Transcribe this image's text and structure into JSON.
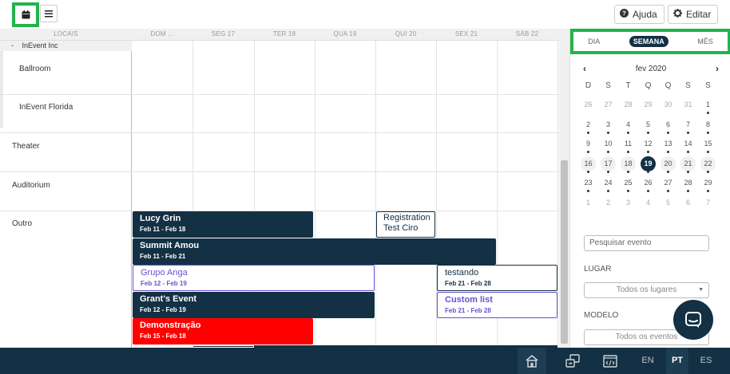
{
  "toolbar": {
    "calendar_icon": "calendar-icon",
    "list_icon": "list-icon",
    "help_label": "Ajuda",
    "edit_label": "Editar"
  },
  "grid": {
    "locations_header": "LOCAIS",
    "day_headers": [
      "DOM ...",
      "SEG 17",
      "TER 18",
      "QUA 19",
      "QUI 20",
      "SEX 21",
      "SÁB 22"
    ],
    "group": "InEvent Inc",
    "group_toggle": "-",
    "rows": [
      "Ballroom",
      "InEvent Florida",
      "Theater",
      "Auditorium",
      "Outro"
    ]
  },
  "events": [
    {
      "title": "Lucy Grin",
      "dates": "Feb 11 - Feb 18",
      "style": "dark"
    },
    {
      "title": "Registration Test Ciro",
      "dates": "",
      "style": "outline"
    },
    {
      "title": "Summit Amou",
      "dates": "Feb 11 - Feb 21",
      "style": "dark"
    },
    {
      "title": "Grupo Anga",
      "dates": "Feb 12 - Feb 19",
      "style": "purple"
    },
    {
      "title": "testando",
      "dates": "Feb 21 - Feb 28",
      "style": "outline"
    },
    {
      "title": "Grant's Event",
      "dates": "Feb 12 - Feb 19",
      "style": "dark"
    },
    {
      "title": "Custom list",
      "dates": "Feb 21 - Feb 28",
      "style": "purple"
    },
    {
      "title": "Demonstração",
      "dates": "Feb 15 - Feb 18",
      "style": "red"
    }
  ],
  "view_tabs": {
    "day": "DIA",
    "week": "SEMANA",
    "month": "MÊS",
    "selected": "SEMANA"
  },
  "calendar": {
    "month_label": "fev 2020",
    "weekdays": [
      "D",
      "S",
      "T",
      "Q",
      "Q",
      "S",
      "S"
    ],
    "selected_day": "19",
    "weeks": [
      [
        "26",
        "27",
        "28",
        "29",
        "30",
        "31",
        "1"
      ],
      [
        "2",
        "3",
        "4",
        "5",
        "6",
        "7",
        "8"
      ],
      [
        "9",
        "10",
        "11",
        "12",
        "13",
        "14",
        "15"
      ],
      [
        "16",
        "17",
        "18",
        "19",
        "20",
        "21",
        "22"
      ],
      [
        "23",
        "24",
        "25",
        "26",
        "27",
        "28",
        "29"
      ],
      [
        "1",
        "2",
        "3",
        "4",
        "5",
        "6",
        "7"
      ]
    ]
  },
  "filters": {
    "search_placeholder": "Pesquisar evento",
    "place_label": "LUGAR",
    "place_value": "Todos os lugares",
    "model_label": "MODELO",
    "model_value": "Todos os eventos"
  },
  "bottom": {
    "languages": [
      "EN",
      "PT",
      "ES"
    ],
    "active_language": "PT"
  },
  "colors": {
    "navy": "#133044",
    "highlight_green": "#22b34a",
    "event_red": "#ff0000",
    "event_purple": "#6a4fd0"
  }
}
